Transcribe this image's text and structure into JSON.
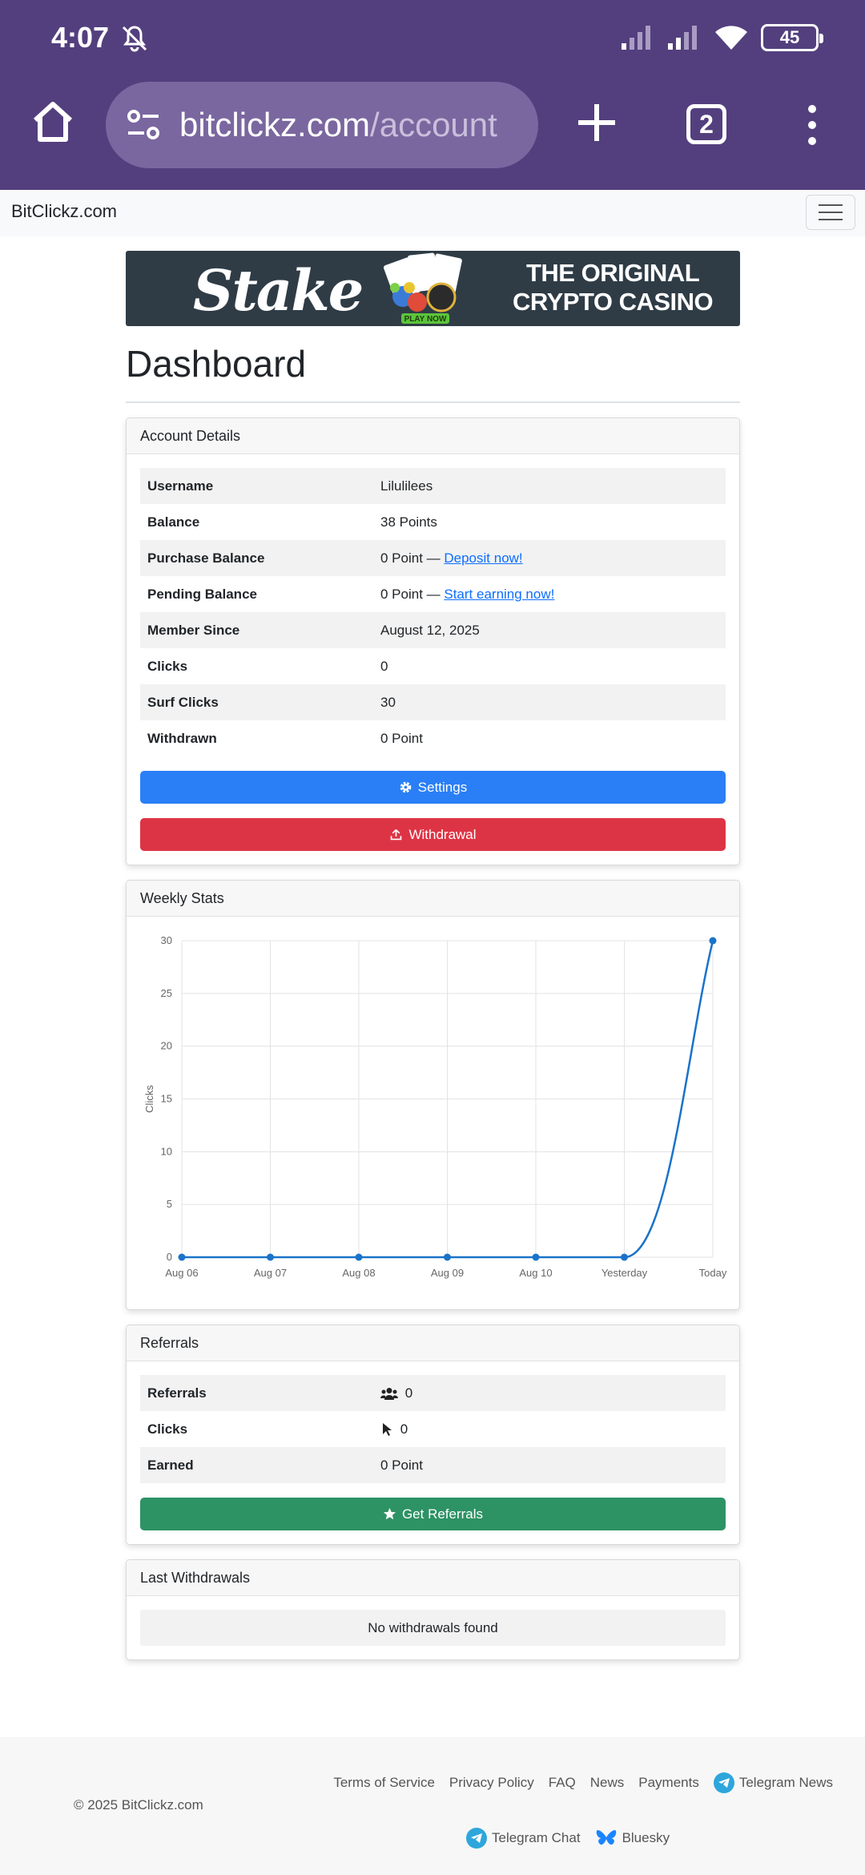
{
  "status_bar": {
    "time": "4:07",
    "battery": "45"
  },
  "browser": {
    "url_host": "bitclickz.com",
    "url_path": "/account",
    "tab_count": "2"
  },
  "navbar": {
    "brand": "BitClickz.com"
  },
  "banner": {
    "logo": "Stake",
    "play": "PLAY NOW",
    "tagline_line1": "THE ORIGINAL",
    "tagline_line2": "CRYPTO CASINO"
  },
  "page": {
    "title": "Dashboard"
  },
  "account": {
    "header": "Account Details",
    "rows": [
      {
        "key": "Username",
        "value": "Lilulilees"
      },
      {
        "key": "Balance",
        "value": "38 Points"
      },
      {
        "key": "Purchase Balance",
        "value": "0 Point — ",
        "link": "Deposit now!"
      },
      {
        "key": "Pending Balance",
        "value": "0 Point — ",
        "link": "Start earning now!"
      },
      {
        "key": "Member Since",
        "value": "August 12, 2025"
      },
      {
        "key": "Clicks",
        "value": "0"
      },
      {
        "key": "Surf Clicks",
        "value": "30"
      },
      {
        "key": "Withdrawn",
        "value": "0 Point"
      }
    ],
    "settings_label": "Settings",
    "withdrawal_label": "Withdrawal"
  },
  "weekly": {
    "header": "Weekly Stats"
  },
  "chart_data": {
    "type": "line",
    "categories": [
      "Aug 06",
      "Aug 07",
      "Aug 08",
      "Aug 09",
      "Aug 10",
      "Yesterday",
      "Today"
    ],
    "series": [
      {
        "values": [
          0,
          0,
          0,
          0,
          0,
          0,
          30
        ]
      }
    ],
    "ylabel": "Clicks",
    "ylim": [
      0,
      30
    ],
    "yticks": [
      0,
      5,
      10,
      15,
      20,
      25,
      30
    ],
    "grid": true,
    "line_color": "#1a73c9"
  },
  "referrals": {
    "header": "Referrals",
    "rows": [
      {
        "key": "Referrals",
        "value": "0",
        "icon": "users-icon"
      },
      {
        "key": "Clicks",
        "value": "0",
        "icon": "cursor-icon"
      },
      {
        "key": "Earned",
        "value": "0 Point"
      }
    ],
    "button_label": "Get Referrals"
  },
  "withdrawals": {
    "header": "Last Withdrawals",
    "empty": "No withdrawals found"
  },
  "footer": {
    "copyright": "© 2025 BitClickz.com",
    "links": [
      "Terms of Service",
      "Privacy Policy",
      "FAQ",
      "News",
      "Payments",
      "Telegram News"
    ],
    "links2": [
      "Telegram Chat",
      "Bluesky"
    ]
  }
}
